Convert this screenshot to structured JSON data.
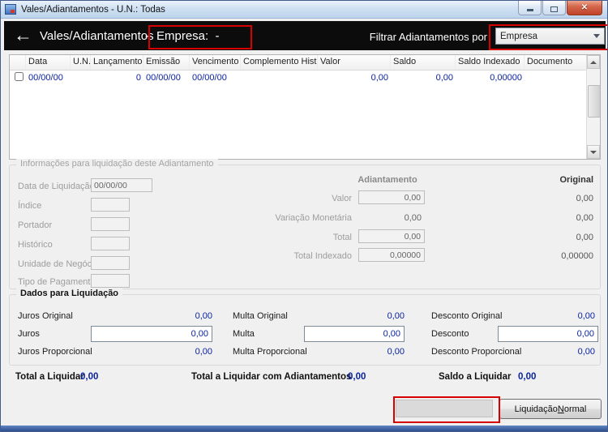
{
  "colors": {
    "annotation_red": "#d60000",
    "value_blue": "#0a23a0",
    "header_bg": "#0c0c0c"
  },
  "icons": {
    "app": "app-icon",
    "minimize": "minimize-icon",
    "maximize": "maximize-icon",
    "close": "close-icon",
    "back": "back-arrow-icon",
    "chevron_down": "chevron-down-icon",
    "scroll_up": "scroll-up-icon",
    "scroll_down": "scroll-down-icon",
    "checkbox": "row-checkbox"
  },
  "titlebar": {
    "title": "Vales/Adiantamentos - U.N.: Todas",
    "close_glyph": "✕"
  },
  "header": {
    "back_icon": "←",
    "title": "Vales/Adiantamentos",
    "separator": "-",
    "empresa": "Empresa:  -",
    "filter_label": "Filtrar Adiantamentos por",
    "filter_combo": {
      "value": "Empresa"
    }
  },
  "grid": {
    "columns": [
      "Data",
      "U.N.",
      "Lançamento",
      "Emissão",
      "Vencimento",
      "Complemento Histórico",
      "Valor",
      "Saldo",
      "Saldo Indexado",
      "Documento"
    ],
    "rows": [
      {
        "checked": false,
        "data": "00/00/00",
        "un": "",
        "lancamento": "0",
        "emissao": "00/00/00",
        "vencimento": "00/00/00",
        "complemento": "",
        "valor": "0,00",
        "saldo": "0,00",
        "saldo_indexado": "0,00000",
        "documento": ""
      }
    ]
  },
  "info_group": {
    "title": "Informações para liquidação deste Adiantamento",
    "fields": [
      {
        "label": "Data de Liquidação",
        "value": "00/00/00"
      },
      {
        "label": "Índice",
        "value": ""
      },
      {
        "label": "Portador",
        "value": ""
      },
      {
        "label": "Histórico",
        "value": ""
      },
      {
        "label": "Unidade de Negócio",
        "value": ""
      },
      {
        "label": "Tipo de Pagamento",
        "value": ""
      }
    ],
    "col_adiantamento": "Adiantamento",
    "col_original": "Original",
    "rows": [
      {
        "label": "Valor",
        "adiantamento": "0,00",
        "original": "0,00"
      },
      {
        "label": "Variação Monetária",
        "adiantamento": "0,00",
        "original": "0,00"
      },
      {
        "label": "Total",
        "adiantamento": "0,00",
        "original": "0,00"
      },
      {
        "label": "Total Indexado",
        "adiantamento": "0,00000",
        "original": "0,00000"
      }
    ]
  },
  "liquidacao_group": {
    "title": "Dados para Liquidação",
    "cols": [
      {
        "original_label": "Juros Original",
        "original_value": "0,00",
        "input_label": "Juros",
        "input_value": "0,00",
        "proporcional_label": "Juros Proporcional",
        "proporcional_value": "0,00"
      },
      {
        "original_label": "Multa Original",
        "original_value": "0,00",
        "input_label": "Multa",
        "input_value": "0,00",
        "proporcional_label": "Multa Proporcional",
        "proporcional_value": "0,00"
      },
      {
        "original_label": "Desconto Original",
        "original_value": "0,00",
        "input_label": "Desconto",
        "input_value": "0,00",
        "proporcional_label": "Desconto Proporcional",
        "proporcional_value": "0,00"
      }
    ]
  },
  "totals": {
    "total_label": "Total a Liquidar",
    "total_value": "0,00",
    "total_adiant_label": "Total a Liquidar com Adiantamentos",
    "total_adiant_value": "0,00",
    "saldo_label": "Saldo a Liquidar",
    "saldo_value": "0,00"
  },
  "footer": {
    "button_prefix": "Liquidação ",
    "button_accel": "N",
    "button_suffix": "ormal"
  }
}
